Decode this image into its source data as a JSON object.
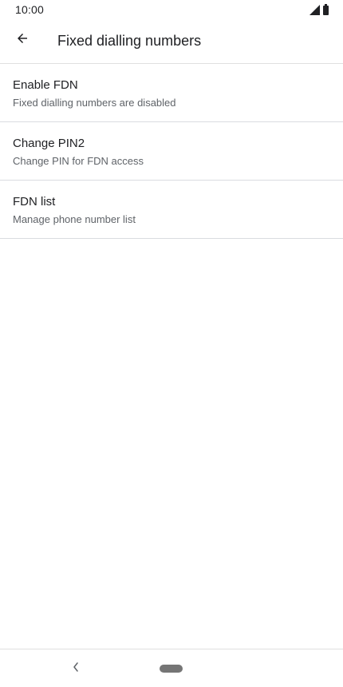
{
  "status_bar": {
    "time": "10:00",
    "icons": [
      "signal-icon",
      "battery-icon"
    ]
  },
  "app_bar": {
    "back_icon": "arrow-back-icon",
    "title": "Fixed dialling numbers"
  },
  "settings": {
    "items": [
      {
        "title": "Enable FDN",
        "summary": "Fixed dialling numbers are disabled"
      },
      {
        "title": "Change PIN2",
        "summary": "Change PIN for FDN access"
      },
      {
        "title": "FDN list",
        "summary": "Manage phone number list"
      }
    ]
  },
  "nav_bar": {
    "back_icon": "nav-back-icon",
    "home_icon": "home-pill-icon"
  },
  "colors": {
    "text_primary": "#202124",
    "text_secondary": "#5f6368",
    "divider": "#dadce0",
    "nav_pill": "#757575"
  }
}
